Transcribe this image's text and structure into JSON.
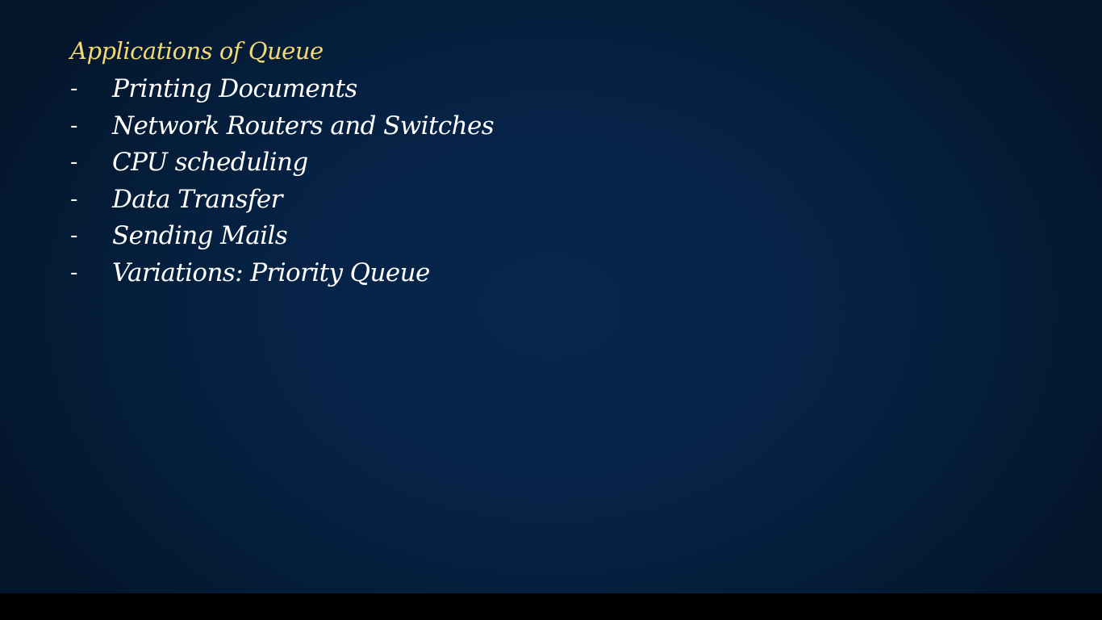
{
  "slide": {
    "title": "Applications of Queue",
    "bullet_symbol": "-",
    "items": [
      "Printing Documents",
      "Network Routers and Switches",
      "CPU scheduling",
      "Data Transfer",
      "Sending Mails",
      "Variations: Priority Queue"
    ]
  },
  "colors": {
    "background": "#05223f",
    "title": "#f2d974",
    "text": "#ffffff",
    "letterbox": "#000000"
  }
}
